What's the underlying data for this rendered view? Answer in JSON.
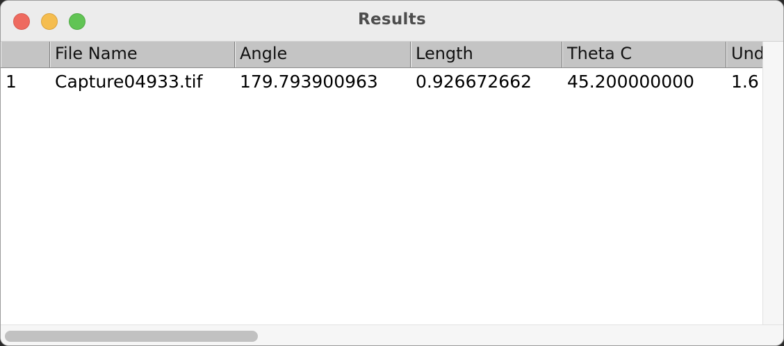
{
  "window": {
    "title": "Results"
  },
  "table": {
    "columns": [
      "",
      "File Name",
      "Angle",
      "Length",
      "Theta C",
      "Und"
    ],
    "rows": [
      [
        "1",
        "Capture04933.tif",
        "179.793900963",
        "0.926672662",
        "45.200000000",
        "1.6"
      ]
    ]
  }
}
